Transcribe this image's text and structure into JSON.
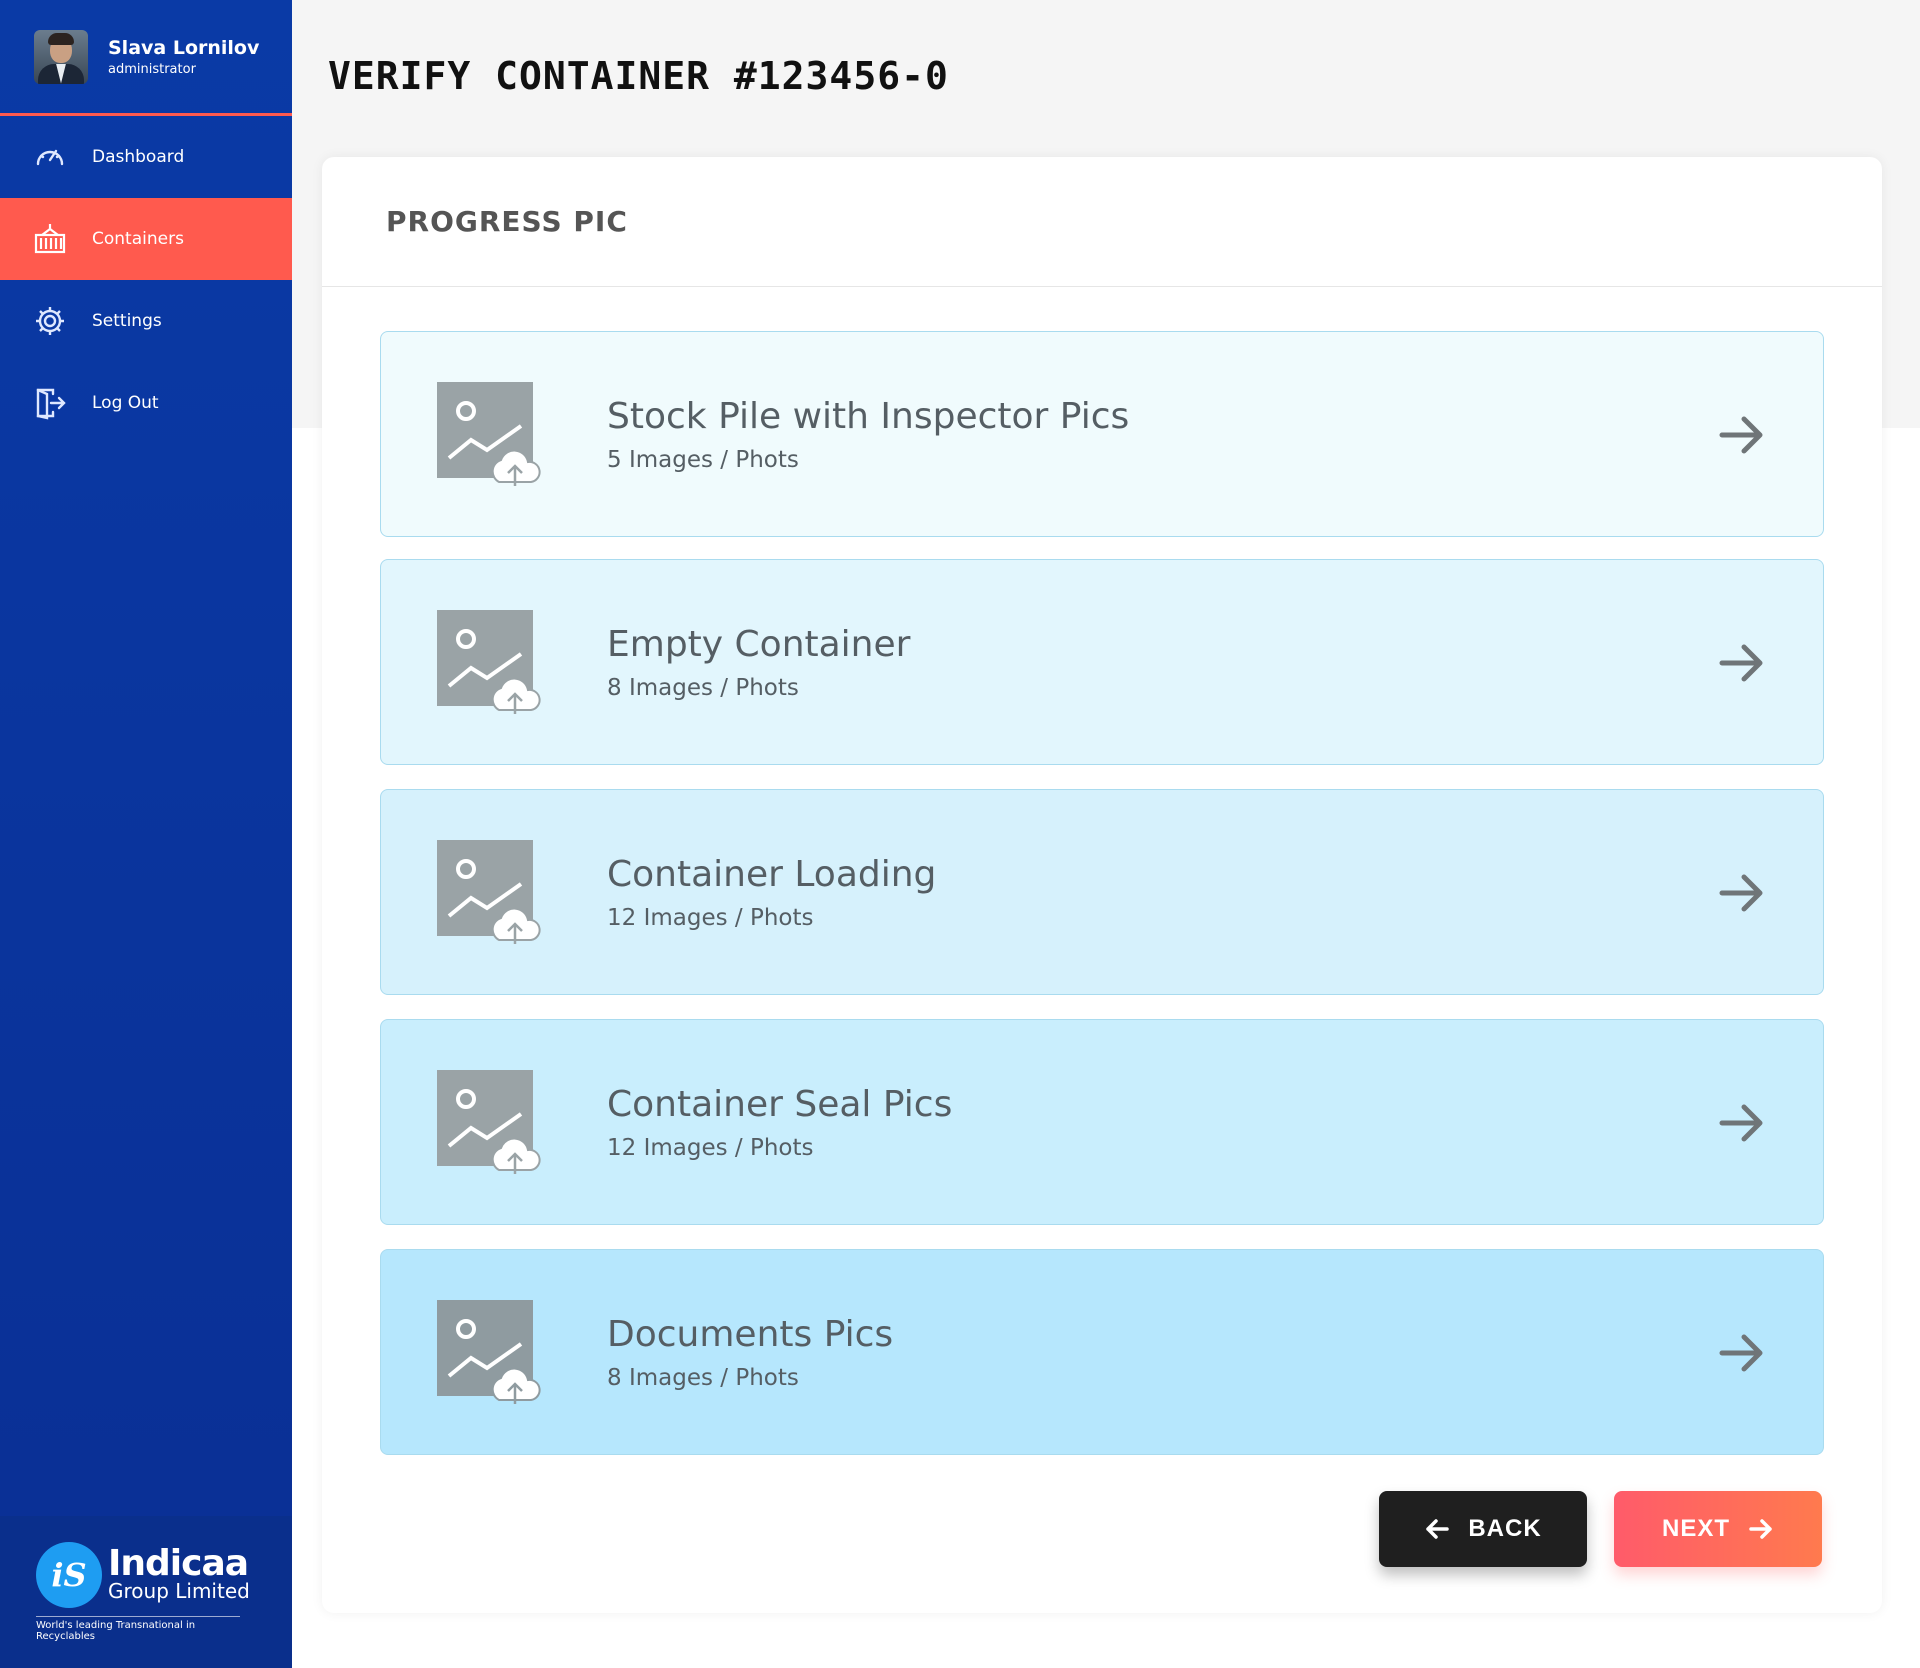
{
  "user": {
    "name": "Slava Lornilov",
    "role": "administrator"
  },
  "nav": [
    {
      "label": "Dashboard",
      "icon": "speedometer-icon",
      "active": false
    },
    {
      "label": "Containers",
      "icon": "container-icon",
      "active": true
    },
    {
      "label": "Settings",
      "icon": "gear-icon",
      "active": false
    },
    {
      "label": "Log Out",
      "icon": "logout-icon",
      "active": false
    }
  ],
  "brand": {
    "mark": "iS",
    "name": "Indicaa",
    "sub": "Group Limited",
    "tagline": "World's leading Transnational in Recyclables"
  },
  "page": {
    "title": "VERIFY CONTAINER #123456-0"
  },
  "panel": {
    "title": "PROGRESS  PIC"
  },
  "cards": [
    {
      "title": "Stock Pile with Inspector Pics",
      "subtitle": "5 Images / Phots",
      "bg": "#f0fbfd"
    },
    {
      "title": "Empty Container",
      "subtitle": "8 Images / Phots",
      "bg": "#e2f6fd"
    },
    {
      "title": "Container Loading",
      "subtitle": "12 Images / Phots",
      "bg": "#d6f1fc"
    },
    {
      "title": "Container Seal Pics",
      "subtitle": "12 Images / Phots",
      "bg": "#c9eefd"
    },
    {
      "title": "Documents Pics",
      "subtitle": "8 Images / Phots",
      "bg": "#b6e7fd"
    }
  ],
  "buttons": {
    "back": "BACK",
    "next": "NEXT"
  },
  "colors": {
    "sidebar": "#0a3aa6",
    "accent": "#ff5a4e",
    "back_button": "#1f1f1f"
  }
}
